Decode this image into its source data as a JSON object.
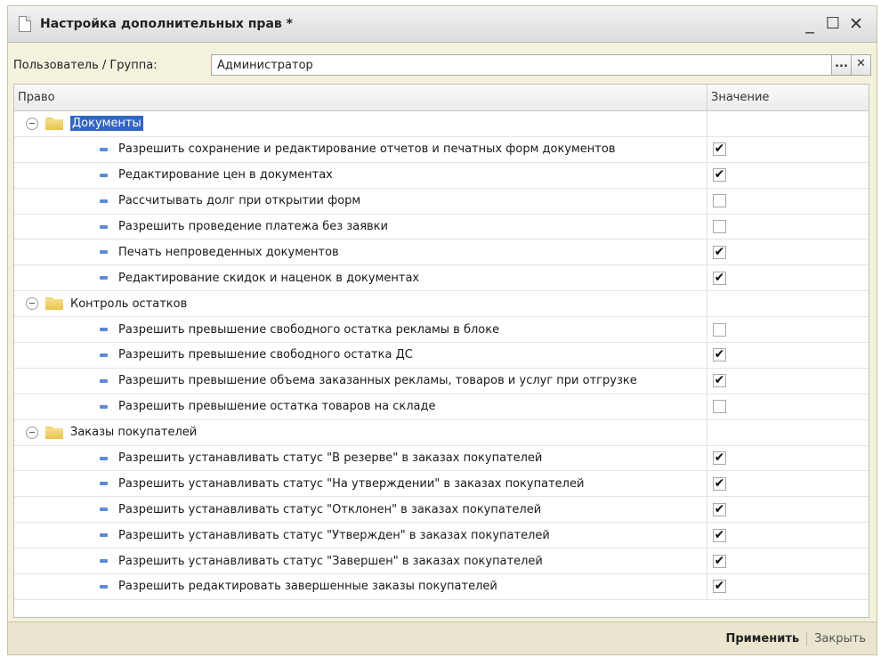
{
  "window": {
    "title": "Настройка дополнительных прав *",
    "minimize": "_",
    "maximize": "☐",
    "close": "✕"
  },
  "user_group": {
    "label": "Пользователь / Группа:",
    "value": "Администратор",
    "browse_button": "...",
    "clear_button": "✕"
  },
  "grid": {
    "headers": {
      "right": "Право",
      "value": "Значение"
    },
    "groups": [
      {
        "label": "Документы",
        "selected": true,
        "items": [
          {
            "label": "Разрешить сохранение и редактирование отчетов и печатных форм документов",
            "checked": true
          },
          {
            "label": "Редактирование цен в документах",
            "checked": true
          },
          {
            "label": "Рассчитывать долг при открытии форм",
            "checked": false
          },
          {
            "label": "Разрешить проведение платежа без заявки",
            "checked": false
          },
          {
            "label": "Печать непроведенных документов",
            "checked": true
          },
          {
            "label": "Редактирование скидок и наценок в документах",
            "checked": true
          }
        ]
      },
      {
        "label": "Контроль остатков",
        "selected": false,
        "items": [
          {
            "label": "Разрешить превышение свободного остатка рекламы в блоке",
            "checked": false
          },
          {
            "label": "Разрешить превышение свободного остатка ДС",
            "checked": true
          },
          {
            "label": "Разрешить превышение объема заказанных рекламы, товаров и услуг при отгрузке",
            "checked": true
          },
          {
            "label": "Разрешить превышение остатка товаров на складе",
            "checked": false
          }
        ]
      },
      {
        "label": "Заказы покупателей",
        "selected": false,
        "items": [
          {
            "label": "Разрешить устанавливать статус \"В резерве\" в заказах покупателей",
            "checked": true
          },
          {
            "label": "Разрешить устанавливать статус \"На утверждении\" в заказах покупателей",
            "checked": true
          },
          {
            "label": "Разрешить устанавливать статус \"Отклонен\" в заказах покупателей",
            "checked": true
          },
          {
            "label": "Разрешить устанавливать статус \"Утвержден\" в заказах покупателей",
            "checked": true
          },
          {
            "label": "Разрешить устанавливать статус \"Завершен\" в заказах покупателей",
            "checked": true
          },
          {
            "label": "Разрешить редактировать завершенные заказы покупателей",
            "checked": true
          }
        ]
      }
    ]
  },
  "footer": {
    "apply": "Применить",
    "close": "Закрыть"
  },
  "colors": {
    "selection": "#3365c2",
    "item_marker": "#5d89d6",
    "window_bg": "#f4f1dd"
  }
}
